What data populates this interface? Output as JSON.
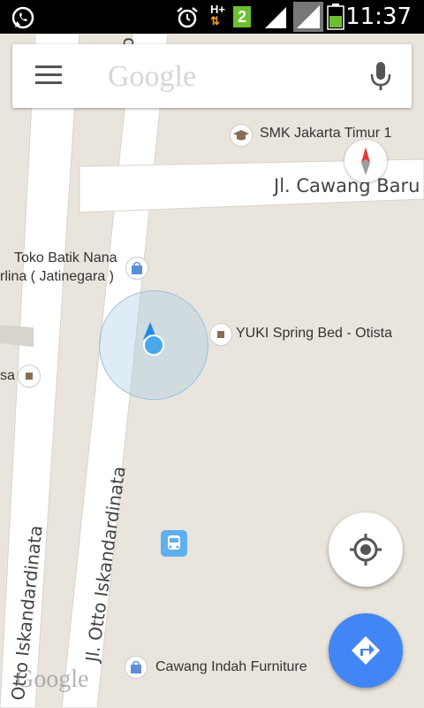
{
  "status_bar": {
    "time": "11:37",
    "icons": [
      "whatsapp-icon",
      "alarm-icon",
      "hplus-data-icon",
      "sim2-icon",
      "signal-icon",
      "signal-icon",
      "battery-icon"
    ],
    "sim_badge": "2",
    "data_badge": "H+"
  },
  "search": {
    "logo_text": "Google",
    "menu_icon": "hamburger-menu-icon",
    "mic_icon": "microphone-icon"
  },
  "map": {
    "streets": [
      {
        "label": "Jl. Otto Iskandardinata"
      },
      {
        "label": "Jl. Cawang Baru"
      },
      {
        "label": "Jl. Otto Iskandardinata"
      },
      {
        "label": "Otto Iskandardinata"
      }
    ],
    "places": [
      {
        "label": "SMK Jakarta Timur 1",
        "icon": "school-icon"
      },
      {
        "label": "Toko Batik Nana",
        "icon": "shopping-bag-icon"
      },
      {
        "label": "rlina ( Jatinegara )"
      },
      {
        "label": "YUKI Spring Bed - Otista",
        "icon": "place-icon"
      },
      {
        "label": "sa",
        "icon": "place-icon"
      },
      {
        "label": "Cawang Indah Furniture",
        "icon": "shopping-bag-icon"
      }
    ],
    "watermark": "Google"
  },
  "colors": {
    "accent": "#4285f4",
    "location_dot": "#4aa8ea",
    "map_bg": "#e9e5dc",
    "road": "#ffffff"
  }
}
